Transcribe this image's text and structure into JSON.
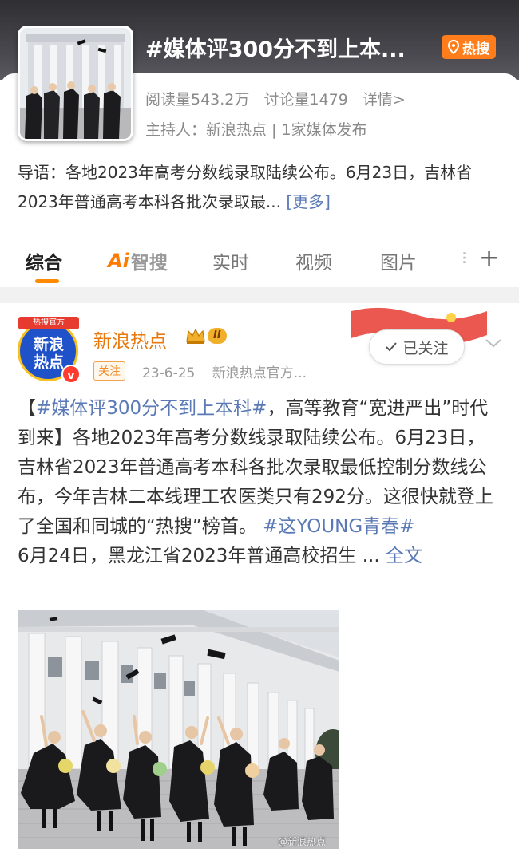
{
  "topic": {
    "title": "#媒体评300分不到上本...",
    "hot_badge": "热搜",
    "stats": {
      "reads": "阅读量543.2万",
      "discussions": "讨论量1479",
      "details": "详情>"
    },
    "host": "主持人：新浪热点 | 1家媒体发布",
    "intro": "导语：各地2023年高考分数线录取陆续公布。6月23日，吉林省2023年普通高考本科各批次录取最... ",
    "more": "[更多]"
  },
  "tabs": {
    "items": [
      {
        "label": "综合"
      },
      {
        "label": "实时"
      },
      {
        "label": "视频"
      },
      {
        "label": "图片"
      }
    ],
    "ai_mark": "Ai",
    "ai_label": "智搜",
    "more_dots": "⁝",
    "plus": "+"
  },
  "post": {
    "avatar": {
      "banner": "热搜官方",
      "line1": "新浪",
      "line2": "热点",
      "verified": "v"
    },
    "username": "新浪热点",
    "vip_level": "II",
    "follow_tag": "关注",
    "date": "23-6-25",
    "source": "新浪热点官方...",
    "followed_label": "已关注",
    "body": {
      "lead_open": "【",
      "topic1": "#媒体评300分不到上本科#",
      "part1": "，高等教育“宽进严出”时代到来】各地2023年高考分数线录取陆续公布。6月23日，吉林省2023年普通高考本科各批次录取最低控制分数线公布，今年吉林二本线理工农医类只有292分。这很快就登上了全国和同城的“热搜”榜首。",
      "topic2": "#这YOUNG青春#",
      "part2": "6月24日，黑龙江省2023年普通高校招生 ... ",
      "full": "全文"
    },
    "watermark": "@新浪热点"
  },
  "colors": {
    "accent": "#ff7d1a",
    "link": "#5a79b5",
    "username": "#e8790d"
  }
}
